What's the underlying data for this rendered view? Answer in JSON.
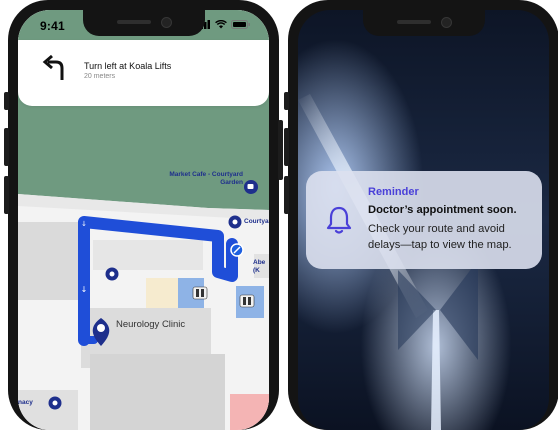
{
  "status_bar": {
    "time": "9:41"
  },
  "navigation": {
    "instruction": "Turn left at Koala Lifts",
    "distance": "20 meters"
  },
  "map": {
    "labels": {
      "market_cafe": "Market Cafe - Courtyard",
      "market_cafe_line2": "Garden",
      "courtyard": "Courtyar",
      "abe": "Abe",
      "abe_line2": "(K",
      "pharmacy": "nacy",
      "neurology_clinic": "Neurology Clinic"
    }
  },
  "notification": {
    "app": "Reminder",
    "title": "Doctor’s appointment soon.",
    "body": "Check your route and avoid delays—tap to view the map."
  },
  "colors": {
    "route": "#1f4ed8",
    "poi": "#1e2f8c",
    "accent": "#4a40d8",
    "map_green": "#6f9a80"
  }
}
